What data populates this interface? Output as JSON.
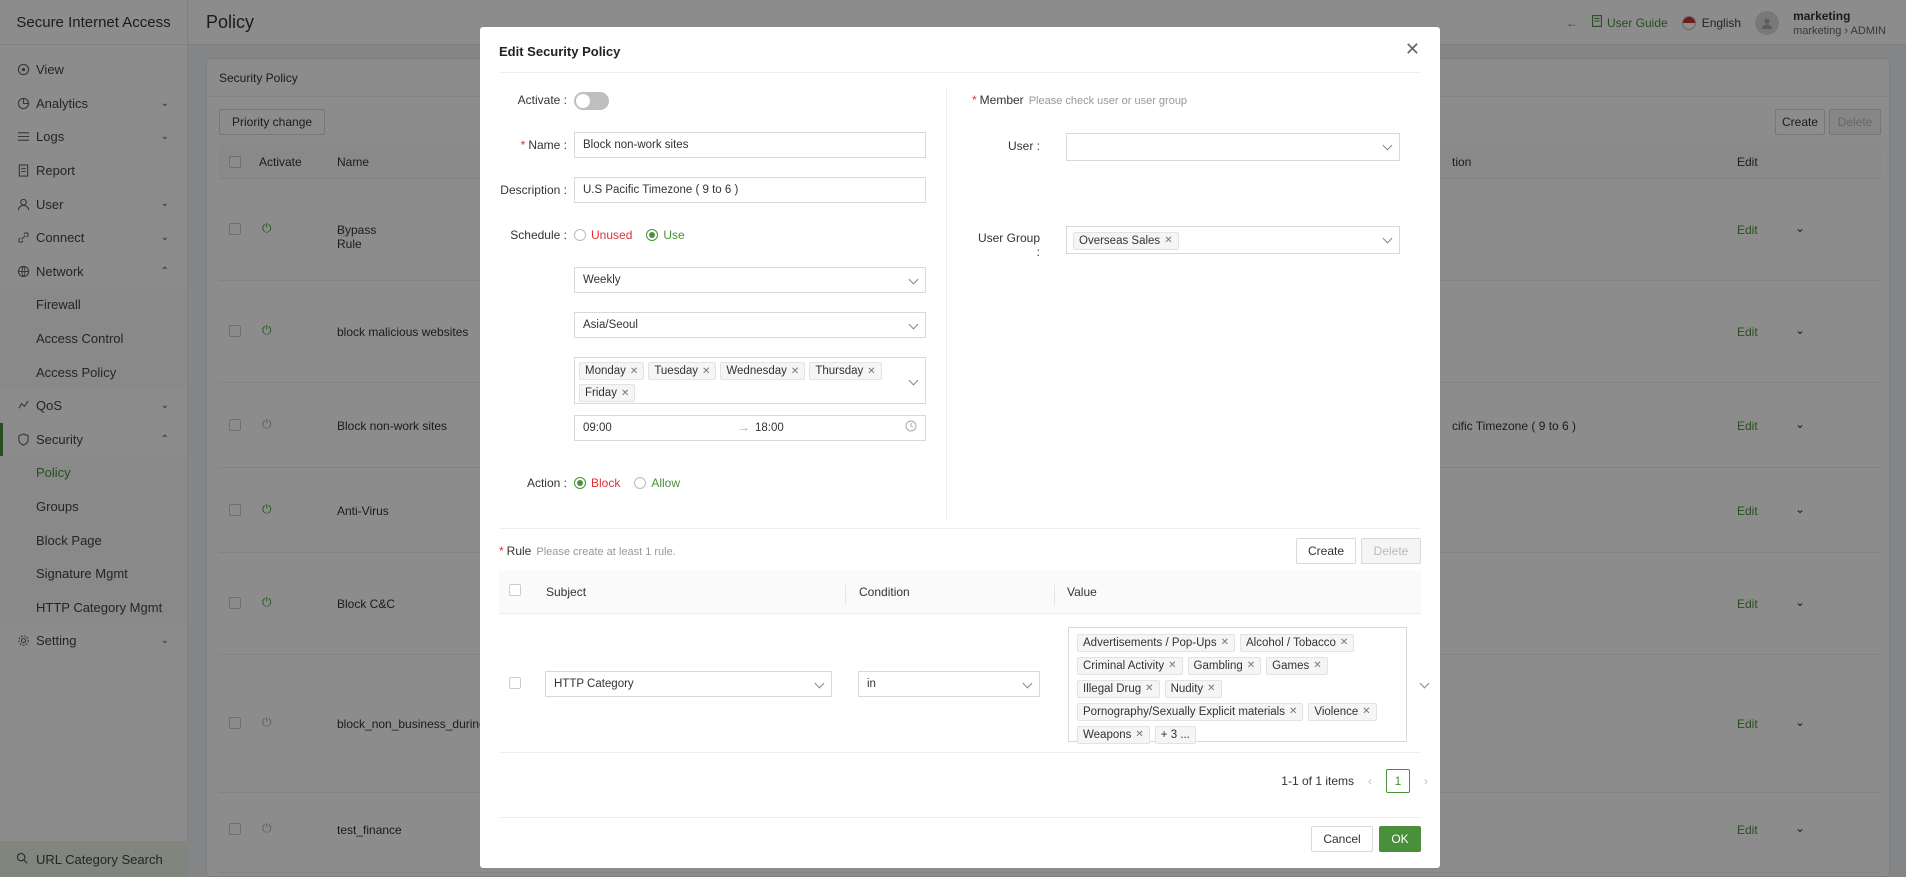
{
  "app": {
    "name": "Secure Internet Access"
  },
  "header": {
    "page_title": "Policy",
    "user_guide": "User Guide",
    "language": "English",
    "user_name": "marketing",
    "user_org": "marketing",
    "user_role": "ADMIN"
  },
  "sidebar": {
    "items": [
      {
        "label": "View",
        "icon": "eye-icon"
      },
      {
        "label": "Analytics",
        "icon": "pie-chart-icon"
      },
      {
        "label": "Logs",
        "icon": "list-icon"
      },
      {
        "label": "Report",
        "icon": "document-icon"
      },
      {
        "label": "User",
        "icon": "user-icon"
      },
      {
        "label": "Connect",
        "icon": "link-icon"
      },
      {
        "label": "Network",
        "icon": "globe-icon"
      },
      {
        "label": "Firewall"
      },
      {
        "label": "Access Control"
      },
      {
        "label": "Access Policy"
      },
      {
        "label": "QoS",
        "icon": "qos-icon"
      },
      {
        "label": "Security",
        "icon": "shield-icon"
      },
      {
        "label": "Policy"
      },
      {
        "label": "Groups"
      },
      {
        "label": "Block Page"
      },
      {
        "label": "Signature Mgmt"
      },
      {
        "label": "HTTP Category Mgmt"
      },
      {
        "label": "Setting",
        "icon": "gear-icon"
      }
    ],
    "url_search": "URL Category Search"
  },
  "background": {
    "section_title": "Security Policy",
    "priority_change": "Priority change",
    "create": "Create",
    "delete": "Delete",
    "columns": {
      "activate": "Activate",
      "name": "Name",
      "description_partial": "tion",
      "edit": "Edit"
    },
    "rows": [
      {
        "name": "Bypass Rule",
        "active": true,
        "desc": "",
        "edit": "Edit"
      },
      {
        "name": "block malicious websites",
        "active": true,
        "desc": "",
        "edit": "Edit"
      },
      {
        "name": "Block non-work sites",
        "active": false,
        "desc": "cific Timezone ( 9 to 6 )",
        "edit": "Edit"
      },
      {
        "name": "Anti-Virus",
        "active": true,
        "desc": "",
        "edit": "Edit"
      },
      {
        "name": "Block C&C",
        "active": true,
        "desc": "",
        "edit": "Edit"
      },
      {
        "name": "block_non_business_during",
        "active": false,
        "desc": "",
        "edit": "Edit"
      },
      {
        "name": "test_finance",
        "active": false,
        "desc": "",
        "edit": "Edit"
      }
    ]
  },
  "modal": {
    "title": "Edit Security Policy",
    "activate_label": "Activate",
    "activate_on": false,
    "name_label": "Name",
    "name_value": "Block non-work sites",
    "description_label": "Description",
    "description_value": "U.S Pacific Timezone ( 9 to 6 )",
    "schedule_label": "Schedule",
    "schedule_unused": "Unused",
    "schedule_use": "Use",
    "schedule_frequency": "Weekly",
    "timezone": "Asia/Seoul",
    "days": [
      "Monday",
      "Tuesday",
      "Wednesday",
      "Thursday",
      "Friday"
    ],
    "time_start": "09:00",
    "time_end": "18:00",
    "action_label": "Action",
    "action_block": "Block",
    "action_allow": "Allow",
    "member_label": "Member",
    "member_hint": "Please check user or user group",
    "user_label": "User",
    "user_group_label": "User Group",
    "user_group_tags": [
      "Overseas Sales"
    ],
    "rule_label": "Rule",
    "rule_hint": "Please create at least 1 rule.",
    "rule_create": "Create",
    "rule_delete": "Delete",
    "rule_columns": {
      "subject": "Subject",
      "condition": "Condition",
      "value": "Value"
    },
    "rule_subject": "HTTP Category",
    "rule_condition": "in",
    "rule_values": [
      "Advertisements / Pop-Ups",
      "Alcohol / Tobacco",
      "Criminal Activity",
      "Gambling",
      "Games",
      "Illegal Drug",
      "Nudity",
      "Pornography/Sexually Explicit materials",
      "Violence",
      "Weapons",
      "+ 3 ..."
    ],
    "pager_summary": "1-1 of 1 items",
    "pager_page": "1",
    "cancel": "Cancel",
    "ok": "OK"
  }
}
